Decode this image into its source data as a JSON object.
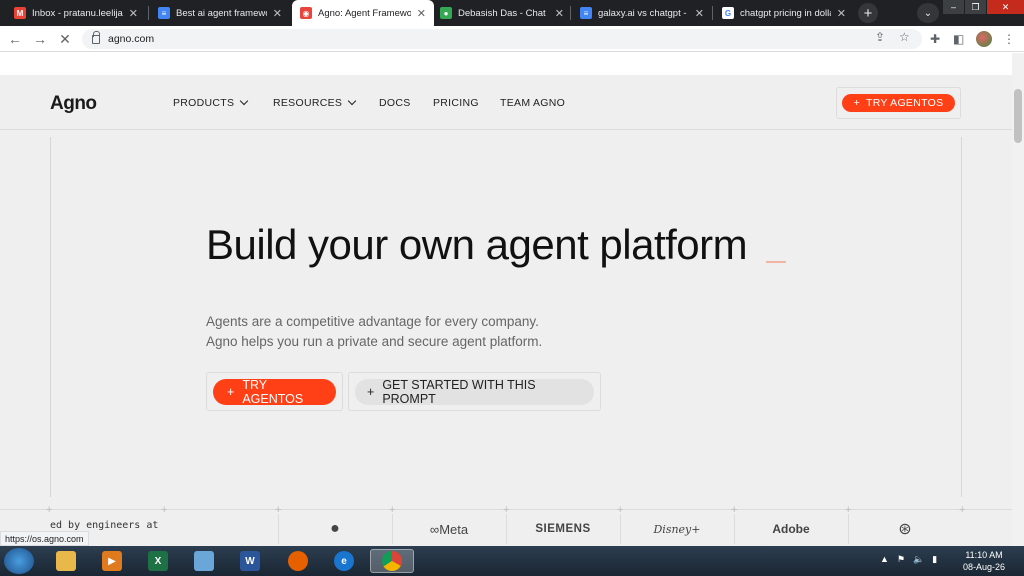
{
  "browser": {
    "tabs": [
      {
        "title": "Inbox - pratanu.leelija@",
        "icon": "gmail-icon",
        "color": "#ea4335",
        "glyph": "M"
      },
      {
        "title": "Best ai agent framewo",
        "icon": "docs-icon",
        "color": "#4285f4",
        "glyph": "≡"
      },
      {
        "title": "Agno: Agent Framewo",
        "icon": "agno-favicon-icon",
        "color": "#e8453c",
        "glyph": "◉"
      },
      {
        "title": "Debasish Das - Chat",
        "icon": "chat-icon",
        "color": "#34a853",
        "glyph": "●"
      },
      {
        "title": "galaxy.ai vs chatgpt - G",
        "icon": "docs-icon",
        "color": "#4285f4",
        "glyph": "≡"
      },
      {
        "title": "chatgpt pricing in dolla",
        "icon": "google-icon",
        "color": "#ffffff",
        "glyph": "G"
      }
    ],
    "new_tab": "+",
    "url": "agno.com",
    "status_url": "https://os.agno.com"
  },
  "site": {
    "logo": "Agno",
    "nav": [
      {
        "label": "PRODUCTS",
        "dropdown": true
      },
      {
        "label": "RESOURCES",
        "dropdown": true
      },
      {
        "label": "DOCS",
        "dropdown": false
      },
      {
        "label": "PRICING",
        "dropdown": false
      },
      {
        "label": "TEAM AGNO",
        "dropdown": false
      }
    ],
    "header_cta": "TRY AGENTOS",
    "hero_title": "Build your own agent platform",
    "hero_cursor": "_",
    "subtitle_line1": "Agents are a competitive advantage for every company.",
    "subtitle_line2": "Agno helps you run a private and secure agent platform.",
    "primary_button": "TRY AGENTOS",
    "secondary_button": "GET STARTED WITH THIS PROMPT",
    "trusted_text": "ed by engineers at",
    "logos": [
      "",
      "Meta",
      "SIEMENS",
      "Disney+",
      "Adobe",
      ""
    ],
    "accent_color": "#ff4017"
  },
  "taskbar": {
    "time": "11:10 AM",
    "date": "08-Aug-26"
  }
}
